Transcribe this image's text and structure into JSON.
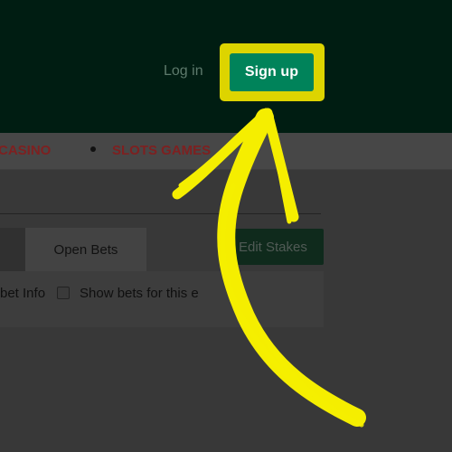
{
  "header": {
    "login_label": "Log in",
    "signup_label": "Sign up"
  },
  "nav": {
    "items": [
      {
        "label": "CASINO"
      },
      {
        "label": "SLOTS GAMES"
      }
    ]
  },
  "betslip": {
    "open_bets_label": "Open Bets",
    "edit_stakes_label": "Edit Stakes",
    "bet_info_label": "bet Info",
    "show_bets_label": "Show bets for this e"
  },
  "colors": {
    "header_bg": "#001d12",
    "signup_bg": "#00835a",
    "highlight": "#ddd400",
    "nav_link": "#7e2020",
    "annotation_arrow": "#f5ee00"
  },
  "icons": {
    "annotation": "yellow-arrow-icon"
  }
}
